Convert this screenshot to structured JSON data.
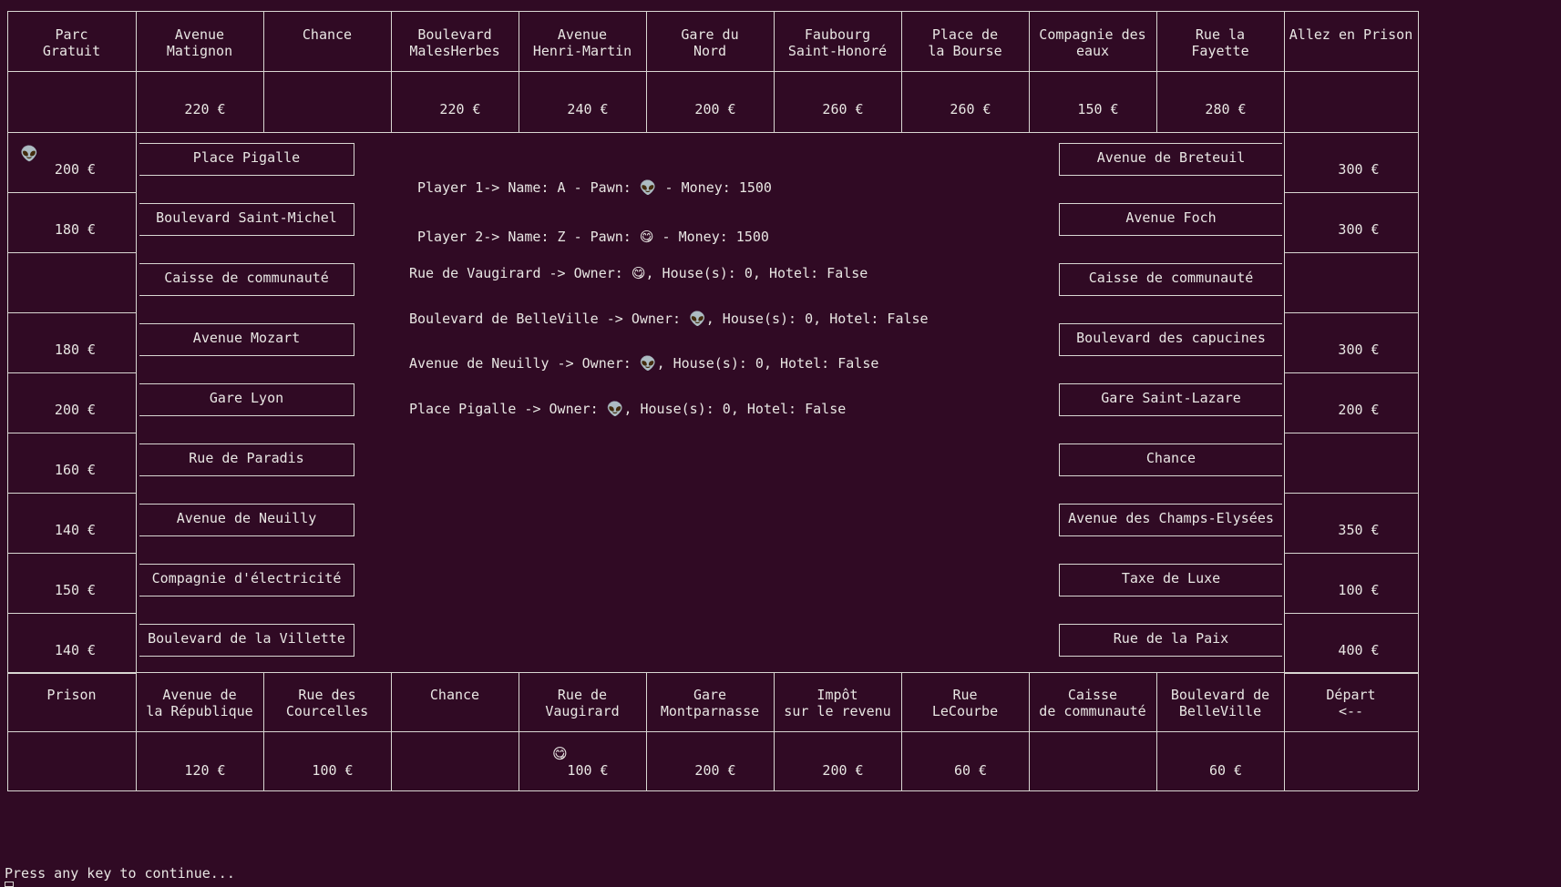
{
  "top_row": [
    {
      "name": "Parc\nGratuit",
      "price": ""
    },
    {
      "name": "Avenue\nMatignon",
      "price": "220 €"
    },
    {
      "name": "Chance",
      "price": ""
    },
    {
      "name": "Boulevard\nMalesHerbes",
      "price": "220 €"
    },
    {
      "name": "Avenue\nHenri-Martin",
      "price": "240 €"
    },
    {
      "name": "Gare du\nNord",
      "price": "200 €"
    },
    {
      "name": "Faubourg\nSaint-Honoré",
      "price": "260 €"
    },
    {
      "name": "Place de\nla Bourse",
      "price": "260 €"
    },
    {
      "name": "Compagnie des\neaux",
      "price": "150 €"
    },
    {
      "name": "Rue la\nFayette",
      "price": "280 €"
    },
    {
      "name": "Allez en Prison",
      "price": ""
    }
  ],
  "left_column": [
    {
      "name": "Place Pigalle",
      "price": "200 €"
    },
    {
      "name": "Boulevard Saint-Michel",
      "price": "180 €"
    },
    {
      "name": "Caisse de communauté",
      "price": ""
    },
    {
      "name": "Avenue Mozart",
      "price": "180 €"
    },
    {
      "name": "Gare Lyon",
      "price": "200 €"
    },
    {
      "name": "Rue de Paradis",
      "price": "160 €"
    },
    {
      "name": "Avenue de Neuilly",
      "price": "140 €"
    },
    {
      "name": "Compagnie d'électricité",
      "price": "150 €"
    },
    {
      "name": "Boulevard de la Villette",
      "price": "140 €"
    }
  ],
  "right_column": [
    {
      "name": "Avenue de Breteuil",
      "price": "300 €"
    },
    {
      "name": "Avenue Foch",
      "price": "300 €"
    },
    {
      "name": "Caisse de communauté",
      "price": ""
    },
    {
      "name": "Boulevard des capucines",
      "price": "300 €"
    },
    {
      "name": "Gare Saint-Lazare",
      "price": "200 €"
    },
    {
      "name": "Chance",
      "price": ""
    },
    {
      "name": "Avenue des Champs-Elysées",
      "price": "350 €"
    },
    {
      "name": "Taxe de Luxe",
      "price": "100 €"
    },
    {
      "name": "Rue de la Paix",
      "price": "400 €"
    }
  ],
  "bottom_row": [
    {
      "name": "Prison",
      "price": ""
    },
    {
      "name": "Avenue de\nla République",
      "price": "120 €"
    },
    {
      "name": "Rue des\nCourcelles",
      "price": "100 €"
    },
    {
      "name": "Chance",
      "price": ""
    },
    {
      "name": "Rue de\nVaugirard",
      "price": "100 €"
    },
    {
      "name": "Gare\nMontparnasse",
      "price": "200 €"
    },
    {
      "name": "Impôt\nsur le revenu",
      "price": "200 €"
    },
    {
      "name": "Rue\nLeCourbe",
      "price": "60 €"
    },
    {
      "name": "Caisse\nde communauté",
      "price": ""
    },
    {
      "name": "Boulevard de\nBelleVille",
      "price": "60 €"
    },
    {
      "name": "Départ\n<--",
      "price": ""
    }
  ],
  "pawns": {
    "alien": "👽",
    "yum": "😋"
  },
  "players": [
    {
      "prefix": "Player 1-> Name: A - Pawn: ",
      "pawn": "👽",
      "suffix": " - Money: 1500"
    },
    {
      "prefix": "Player 2-> Name: Z - Pawn: ",
      "pawn": "😋",
      "suffix": " - Money: 1500"
    }
  ],
  "ownership": [
    {
      "prefix": "Rue de Vaugirard -> Owner: ",
      "owner": "😋",
      "suffix": ", House(s): 0, Hotel: False"
    },
    {
      "prefix": "Boulevard de BelleVille -> Owner: ",
      "owner": "👽",
      "suffix": ", House(s): 0, Hotel: False"
    },
    {
      "prefix": "Avenue de Neuilly -> Owner: ",
      "owner": "👽",
      "suffix": ", House(s): 0, Hotel: False"
    },
    {
      "prefix": "Place Pigalle -> Owner: ",
      "owner": "👽",
      "suffix": ", House(s): 0, Hotel: False"
    }
  ],
  "prompt": "Press any key to continue..."
}
